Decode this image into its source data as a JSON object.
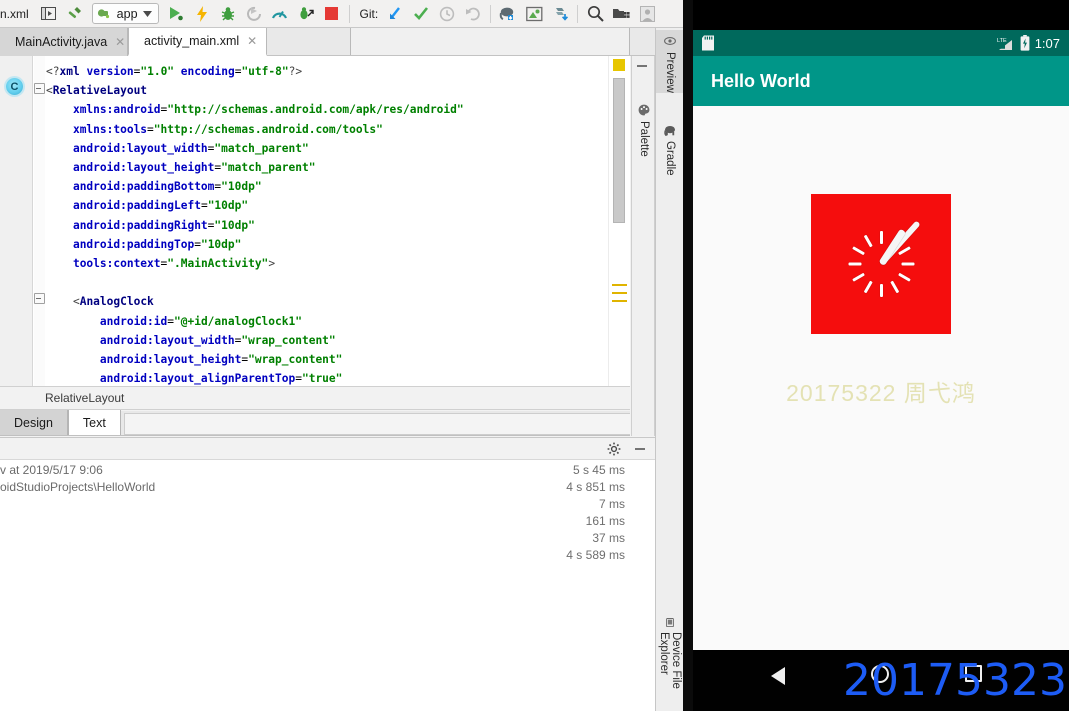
{
  "ide": {
    "toolbar": {
      "filename": "n.xml",
      "module_label": "app",
      "git_label": "Git:",
      "icons": [
        "project-structure-icon",
        "build-hammer-icon",
        "run-icon",
        "debug-lightning-icon",
        "debug-bug-icon",
        "rerun-icon",
        "profiler-icon",
        "attach-debugger-icon",
        "stop-icon",
        "git-update-icon",
        "git-commit-check-icon",
        "git-history-icon",
        "git-revert-icon",
        "avd-manager-icon",
        "sdk-manager-icon",
        "sync-gradle-icon",
        "search-icon",
        "project-window-icon",
        "user-avatar-icon"
      ]
    },
    "tabs": [
      {
        "label": "MainActivity.java",
        "active": false,
        "icon": "java-file-icon"
      },
      {
        "label": "activity_main.xml",
        "active": true,
        "icon": "xml-layout-file-icon"
      }
    ],
    "editor": {
      "gutter_marker": "C",
      "code_lines": [
        "<?xml version=\"1.0\" encoding=\"utf-8\"?>",
        "<RelativeLayout",
        "    xmlns:android=\"http://schemas.android.com/apk/res/android\"",
        "    xmlns:tools=\"http://schemas.android.com/tools\"",
        "    android:layout_width=\"match_parent\"",
        "    android:layout_height=\"match_parent\"",
        "    android:paddingBottom=\"10dp\"",
        "    android:paddingLeft=\"10dp\"",
        "    android:paddingRight=\"10dp\"",
        "    android:paddingTop=\"10dp\"",
        "    tools:context=\".MainActivity\">",
        "",
        "    <AnalogClock",
        "        android:id=\"@+id/analogClock1\"",
        "        android:layout_width=\"wrap_content\"",
        "        android:layout_height=\"wrap_content\"",
        "        android:layout_alignParentTop=\"true\""
      ]
    },
    "breadcrumb": "RelativeLayout",
    "design_text_tabs": [
      {
        "label": "Design",
        "active": false
      },
      {
        "label": "Text",
        "active": true
      }
    ],
    "palette_tab": "Palette",
    "build_panel": {
      "settings_icon": "gear-icon",
      "minimize_icon": "minimize-icon",
      "rows": [
        {
          "text": "v at 2019/5/17 9:06",
          "duration": "5 s 45 ms"
        },
        {
          "text": "oidStudioProjects\\HelloWorld",
          "duration": "4 s 851 ms"
        },
        {
          "text": "",
          "duration": "7 ms"
        },
        {
          "text": "",
          "duration": "161 ms"
        },
        {
          "text": "",
          "duration": "37 ms"
        },
        {
          "text": "",
          "duration": "4 s 589 ms"
        }
      ]
    },
    "right_strip_tabs": [
      {
        "label": "Preview",
        "icon": "eye-icon",
        "selected": true
      },
      {
        "label": "Gradle",
        "icon": "elephant-icon",
        "selected": false
      },
      {
        "label": "Device File Explorer",
        "icon": "device-icon",
        "selected": false
      }
    ]
  },
  "emulator": {
    "status_bar": {
      "left_icon": "sd-card-icon",
      "signal_icon": "lte-signal-icon",
      "battery_icon": "battery-charging-icon",
      "time": "1:07"
    },
    "app_bar": {
      "title": "Hello World"
    },
    "content": {
      "analog_clock": {
        "name": "analog-clock-widget",
        "face_color": "#f50d0d",
        "tick_color": "#ffffff",
        "hand_color": "#f6f6f6",
        "hour_angle": 33,
        "minute_angle": 42
      },
      "label_text": "20175322 周弋鸿",
      "label_color": "#e4e2b4"
    },
    "nav_bar": {
      "back_icon": "back-triangle-icon",
      "home_icon": "home-circle-icon",
      "recents_icon": "recents-square-icon",
      "overlay_number": "20175323",
      "overlay_color": "#1d5cf5"
    }
  }
}
